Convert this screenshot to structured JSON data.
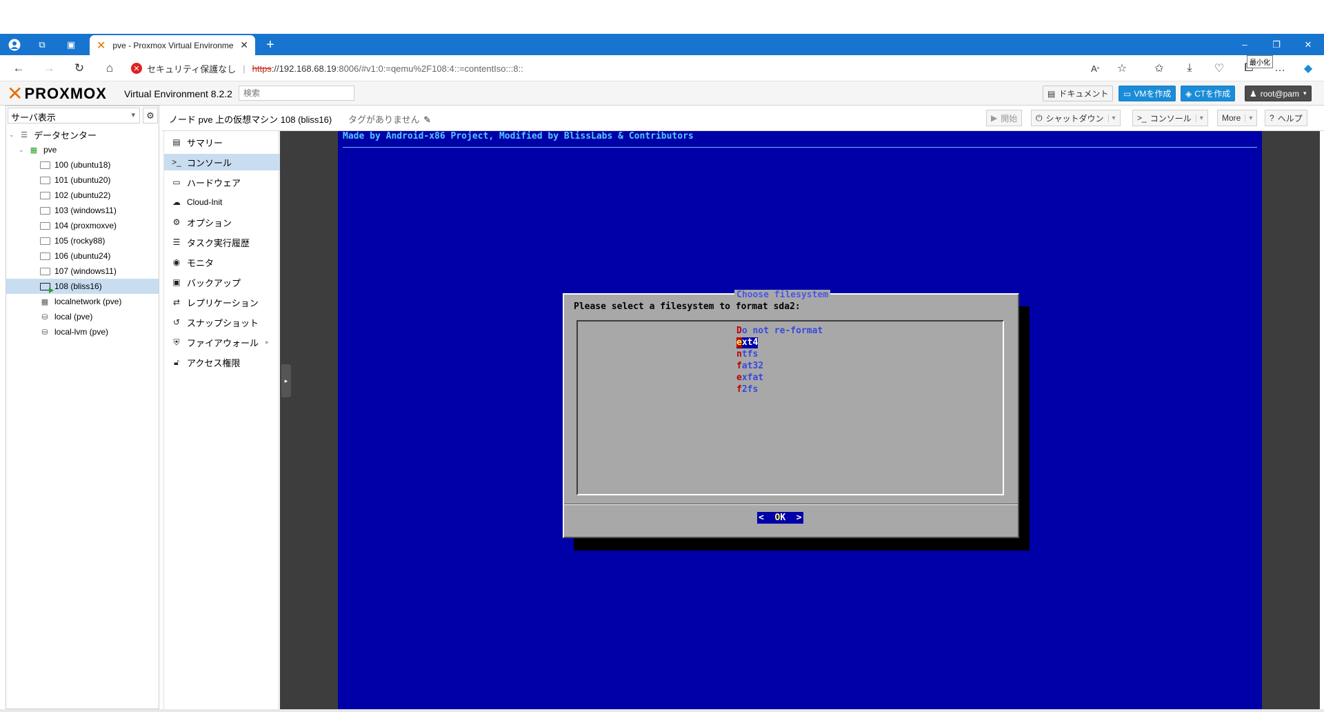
{
  "browser": {
    "tab_title": "pve - Proxmox Virtual Environme",
    "new_tab": "+",
    "win_min": "–",
    "win_restore": "❐",
    "win_close": "✕",
    "tooltip": "最小化",
    "security_label": "セキュリティ保護なし",
    "url_scheme": "https",
    "url_host": "://192.168.68.19",
    "url_rest": ":8006/#v1:0:=qemu%2F108:4::=contentIso:::8::",
    "copilot": "◆"
  },
  "pve": {
    "brand": "PROXMOX",
    "version": "Virtual Environment 8.2.2",
    "search_placeholder": "検索",
    "docs": "ドキュメント",
    "create_vm": "VMを作成",
    "create_ct": "CTを作成",
    "user": "root@pam"
  },
  "tree": {
    "view": "サーバ表示",
    "datacenter": "データセンター",
    "node": "pve",
    "items": [
      {
        "label": "100 (ubuntu18)"
      },
      {
        "label": "101 (ubuntu20)"
      },
      {
        "label": "102 (ubuntu22)"
      },
      {
        "label": "103 (windows11)"
      },
      {
        "label": "104 (proxmoxve)"
      },
      {
        "label": "105 (rocky88)"
      },
      {
        "label": "106 (ubuntu24)"
      },
      {
        "label": "107 (windows11)"
      },
      {
        "label": "108 (bliss16)"
      }
    ],
    "network": "localnetwork (pve)",
    "storage_local": "local (pve)",
    "storage_lvm": "local-lvm (pve)"
  },
  "content": {
    "title": "ノード pve 上の仮想マシン 108 (bliss16)",
    "tags": "タグがありません",
    "start": "開始",
    "shutdown": "シャットダウン",
    "console": "コンソール",
    "more": "More",
    "help": "ヘルプ"
  },
  "menu": [
    {
      "label": "サマリー",
      "icon": "book-icon"
    },
    {
      "label": "コンソール",
      "icon": "terminal-icon"
    },
    {
      "label": "ハードウェア",
      "icon": "desktop-icon"
    },
    {
      "label": "Cloud-Init",
      "icon": "cloud-icon"
    },
    {
      "label": "オプション",
      "icon": "gear-icon"
    },
    {
      "label": "タスク実行履歴",
      "icon": "list-icon"
    },
    {
      "label": "モニタ",
      "icon": "eye-icon"
    },
    {
      "label": "バックアップ",
      "icon": "floppy-icon"
    },
    {
      "label": "レプリケーション",
      "icon": "retweet-icon"
    },
    {
      "label": "スナップショット",
      "icon": "history-icon"
    },
    {
      "label": "ファイアウォール",
      "icon": "shield-icon"
    },
    {
      "label": "アクセス権限",
      "icon": "unlock-icon"
    }
  ],
  "console": {
    "banner": "Made by Android-x86 Project, Modified by BlissLabs & Contributors",
    "dialog_title": "Choose filesystem",
    "prompt": "Please select a filesystem to format sda2:",
    "options": [
      {
        "hotkey": "D",
        "rest": "o not re-format"
      },
      {
        "hotkey": "e",
        "rest": "xt4"
      },
      {
        "hotkey": "n",
        "rest": "tfs"
      },
      {
        "hotkey": "f",
        "rest": "at32"
      },
      {
        "hotkey": "e",
        "rest": "xfat"
      },
      {
        "hotkey": "f",
        "rest": "2fs"
      }
    ],
    "selected_index": 1,
    "ok_left": "<  ",
    "ok_hotkey": "O",
    "ok_rest": "K",
    "ok_right": "  >"
  },
  "colors": {
    "screen_bg": "#0000a8",
    "accent": "#1a8cd8",
    "brand_orange": "#e57000"
  }
}
